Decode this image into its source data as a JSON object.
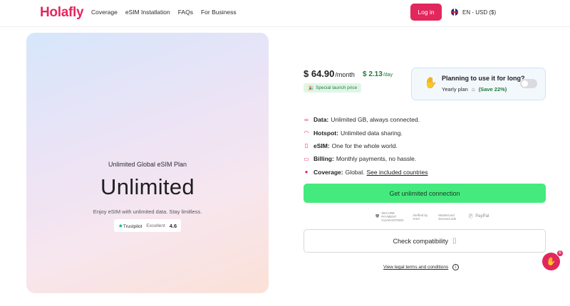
{
  "header": {
    "logo": "Holafly",
    "nav": [
      "Coverage",
      "eSIM Installation",
      "FAQs",
      "For Business"
    ],
    "login_label": "Log in",
    "locale": "EN - USD ($)"
  },
  "hero": {
    "kicker": "Unlimited Global eSIM Plan",
    "title": "Unlimited",
    "subtitle": "Enjoy eSIM with unlimited data. Stay limitless.",
    "trustpilot": {
      "brand": "Trustpilot",
      "label": "Excellent",
      "rating": "4.6"
    }
  },
  "pricing": {
    "price": "$ 64.90",
    "price_unit": "/month",
    "day_price": "$ 2.13",
    "day_unit": "/day",
    "launch_badge": "Special launch price"
  },
  "plan_box": {
    "question": "Planning to use it for long?",
    "yearly_label": "Yearly plan",
    "save_label": "(Save 22%)",
    "toggle_on": false
  },
  "features": [
    {
      "icon": "infinity-icon",
      "key": "Data:",
      "value": "Unlimited GB, always connected.",
      "link": ""
    },
    {
      "icon": "hotspot-icon",
      "key": "Hotspot:",
      "value": "Unlimited data sharing.",
      "link": ""
    },
    {
      "icon": "sim-icon",
      "key": "eSIM:",
      "value": "One for the whole world.",
      "link": ""
    },
    {
      "icon": "billing-icon",
      "key": "Billing:",
      "value": "Monthly payments, no hassle.",
      "link": ""
    },
    {
      "icon": "globe-icon",
      "key": "Coverage:",
      "value": "Global.",
      "link": "See included countries"
    }
  ],
  "cta_label": "Get unlimited connection",
  "payments": {
    "secure": "SECURE PAYMENT GUARANTEED",
    "visa": "Verified by VISA",
    "mastercard": "Mastercard SecureCode",
    "paypal": "PayPal"
  },
  "compat_label": "Check compatibility",
  "legal_label": "View legal terms and conditions",
  "chat": {
    "badge": "6"
  },
  "colors": {
    "brand": "#e2275d",
    "cta": "#44ea7e",
    "savings": "#1f7a3c"
  }
}
